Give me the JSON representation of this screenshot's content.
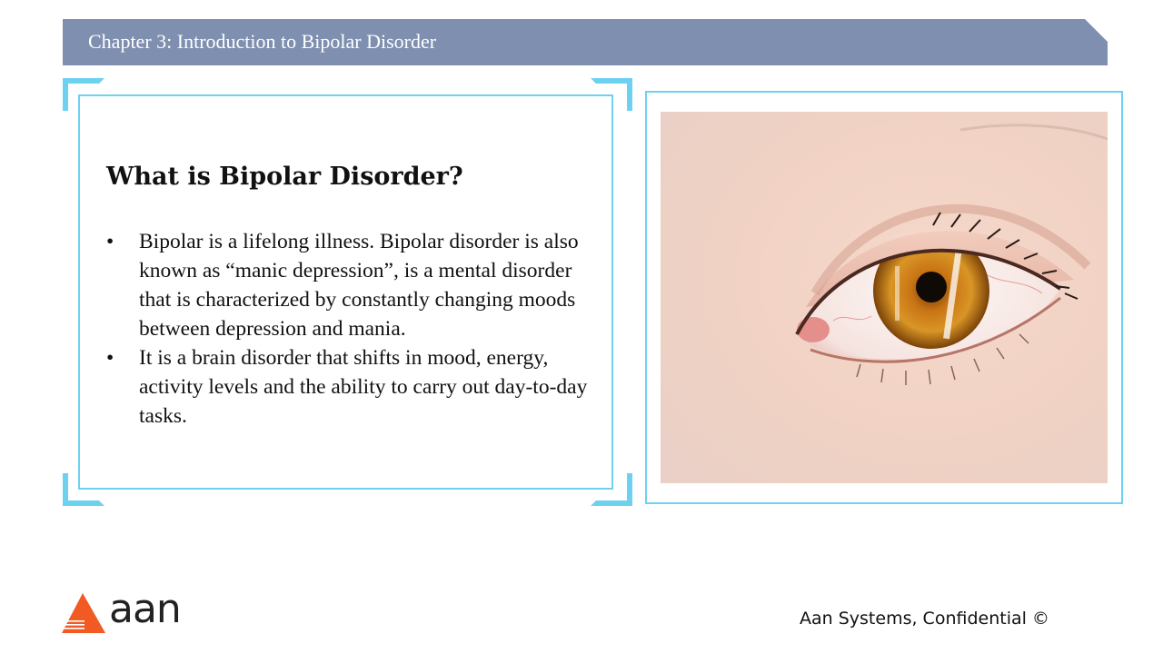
{
  "header": {
    "title": "Chapter 3: Introduction to Bipolar Disorder"
  },
  "content": {
    "heading": "What is Bipolar Disorder?",
    "bullet_symbol": "•",
    "bullets": [
      "Bipolar is a lifelong illness. Bipolar disorder is also known as “manic depression”, is a mental disorder that is characterized by constantly changing moods between depression and mania.",
      "It is a brain disorder that shifts in mood, energy, activity levels and the ability to carry out day-to-day tasks."
    ]
  },
  "image": {
    "icon": "eye-photo"
  },
  "footer": {
    "logo_text": "aan",
    "confidential": "Aan Systems, Confidential ©"
  },
  "colors": {
    "banner": "#7f8faf",
    "accent": "#6ed1f0",
    "logo_orange": "#f15a22"
  }
}
